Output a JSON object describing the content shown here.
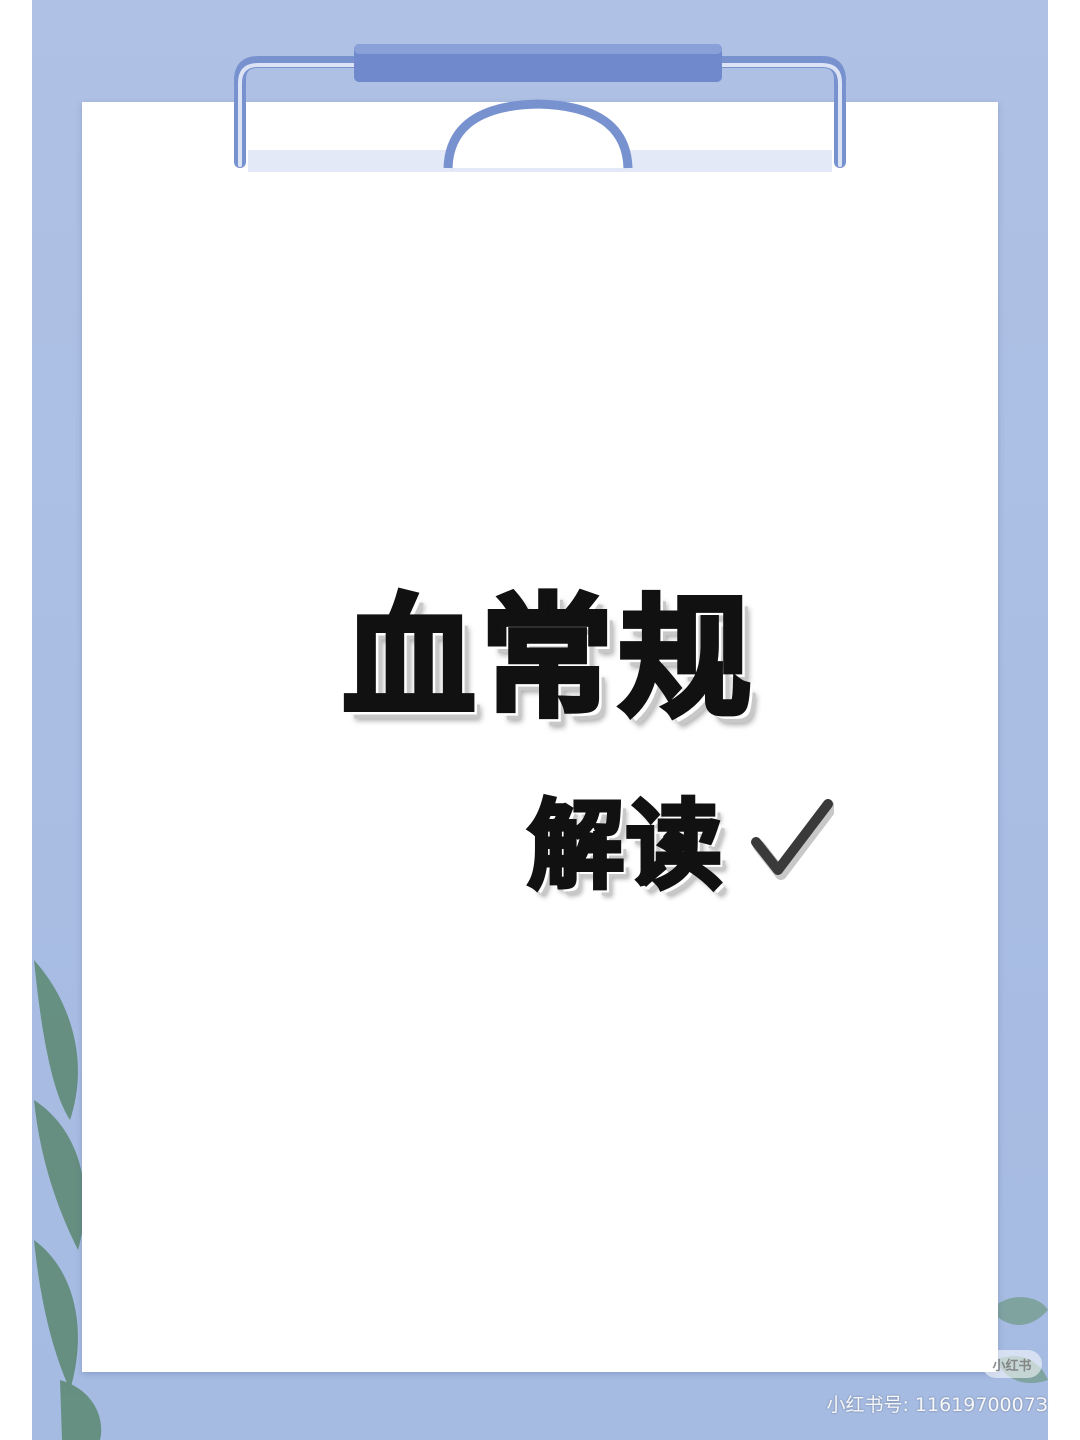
{
  "cover": {
    "title": "血常规",
    "subtitle": "解读",
    "check_icon": "checkmark-icon"
  },
  "watermark": {
    "badge": "小红书",
    "user_id": "小红书号: 1161970007З"
  },
  "colors": {
    "board": "#afc1e4",
    "clip": "#7892cf",
    "paper": "#ffffff",
    "text": "#111111",
    "leaf": "#4f7a66"
  }
}
